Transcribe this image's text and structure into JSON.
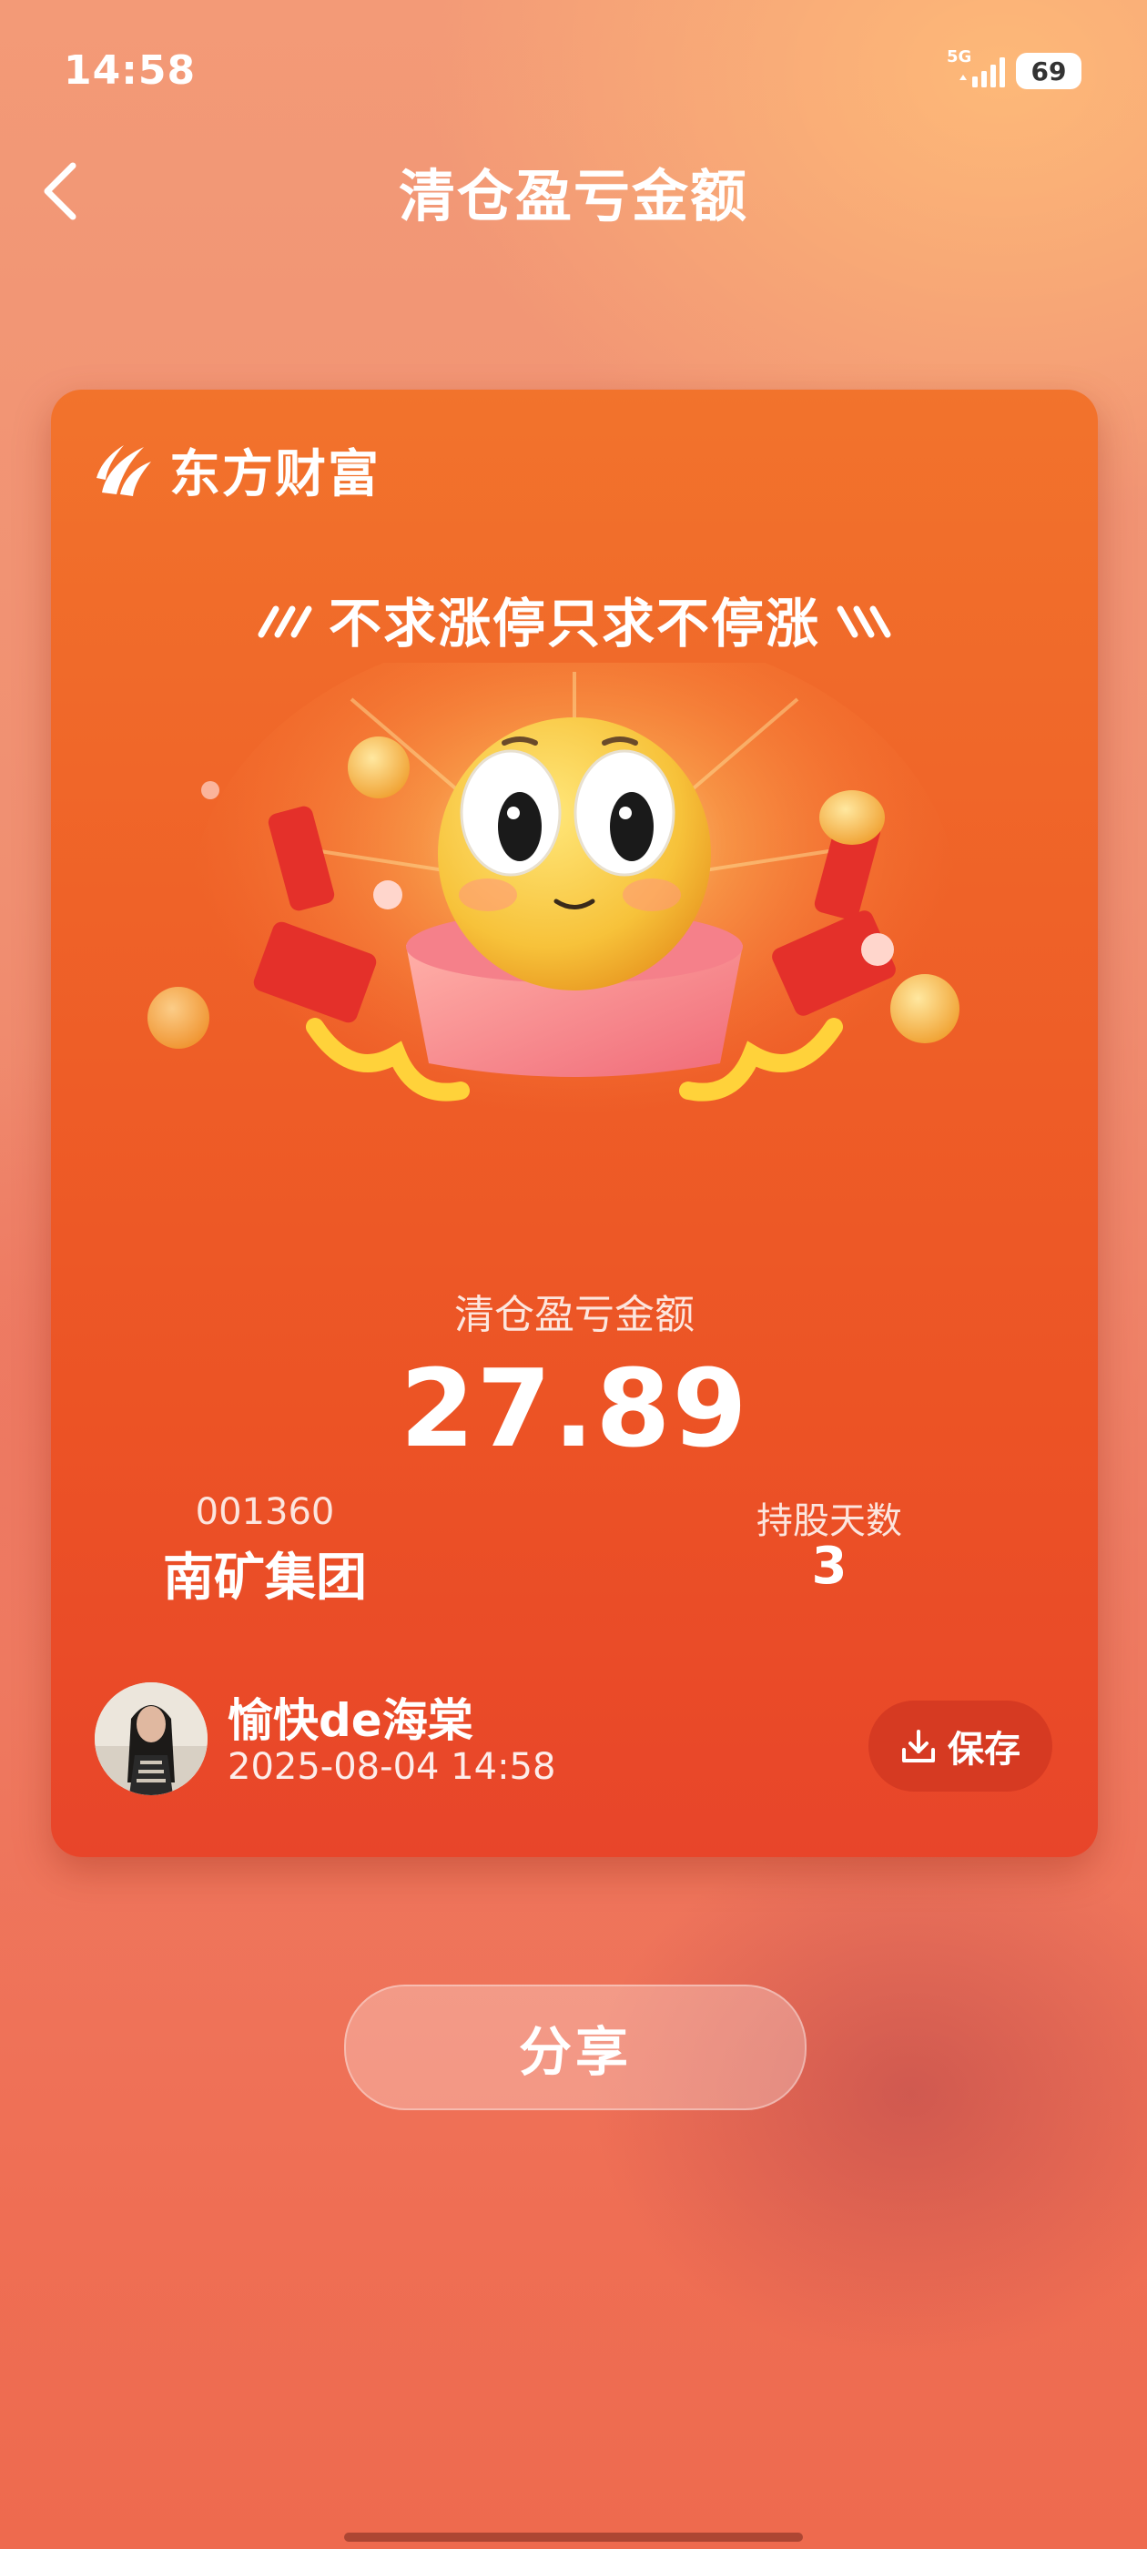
{
  "status_bar": {
    "time": "14:58",
    "network": "5G",
    "battery": "69"
  },
  "nav": {
    "title": "清仓盈亏金额"
  },
  "card": {
    "brand": "东方财富",
    "slogan": "不求涨停只求不停涨",
    "metric_label": "清仓盈亏金额",
    "metric_value": "27.89",
    "stock": {
      "code": "001360",
      "name": "南矿集团"
    },
    "holding_days": {
      "label": "持股天数",
      "value": "3"
    },
    "user": {
      "name": "愉快de海棠",
      "timestamp": "2025-08-04 14:58"
    },
    "save_label": "保存"
  },
  "share_label": "分享",
  "colors": {
    "card_top": "#f2732c",
    "card_bottom": "#e8452a",
    "save_button": "#d63a22"
  }
}
